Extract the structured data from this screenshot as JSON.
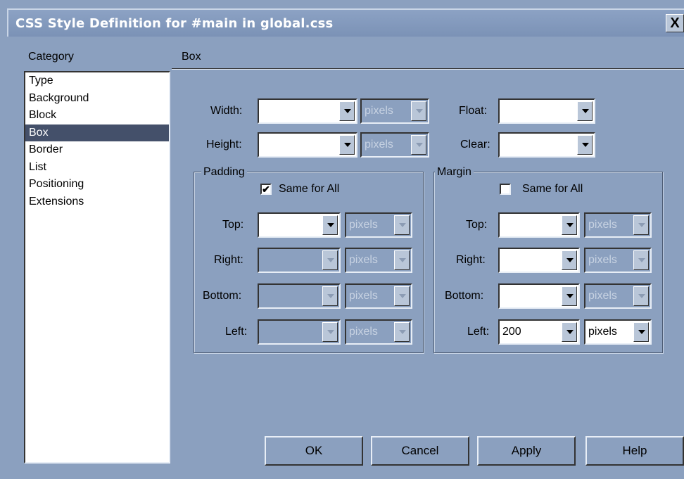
{
  "window": {
    "title": "CSS Style Definition for #main in global.css",
    "close_label": "X"
  },
  "category": {
    "heading": "Category",
    "items": [
      "Type",
      "Background",
      "Block",
      "Box",
      "Border",
      "List",
      "Positioning",
      "Extensions"
    ],
    "selected": "Box"
  },
  "section_title": "Box",
  "width": {
    "label": "Width:",
    "value": "",
    "unit": "pixels"
  },
  "height": {
    "label": "Height:",
    "value": "",
    "unit": "pixels"
  },
  "float": {
    "label": "Float:",
    "value": ""
  },
  "clear": {
    "label": "Clear:",
    "value": ""
  },
  "padding": {
    "legend": "Padding",
    "same_for_all": {
      "label": "Same for All",
      "checked": true,
      "mark": "✔"
    },
    "top": {
      "label": "Top:",
      "value": "",
      "unit": "pixels"
    },
    "right": {
      "label": "Right:",
      "value": "",
      "unit": "pixels"
    },
    "bottom": {
      "label": "Bottom:",
      "value": "",
      "unit": "pixels"
    },
    "left": {
      "label": "Left:",
      "value": "",
      "unit": "pixels"
    }
  },
  "margin": {
    "legend": "Margin",
    "same_for_all": {
      "label": "Same for All",
      "checked": false
    },
    "top": {
      "label": "Top:",
      "value": "",
      "unit": "pixels"
    },
    "right": {
      "label": "Right:",
      "value": "",
      "unit": "pixels"
    },
    "bottom": {
      "label": "Bottom:",
      "value": "",
      "unit": "pixels"
    },
    "left": {
      "label": "Left:",
      "value": "200",
      "unit": "pixels"
    }
  },
  "buttons": {
    "ok": "OK",
    "cancel": "Cancel",
    "apply": "Apply",
    "help": "Help"
  },
  "colors": {
    "dialog_bg": "#8ba0bf",
    "selection_bg": "#44506a"
  }
}
